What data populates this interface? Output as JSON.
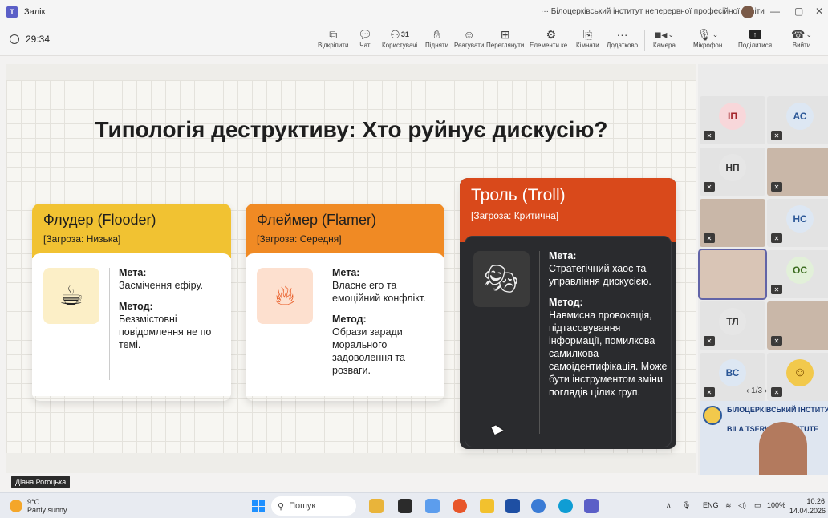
{
  "titlebar": {
    "title": "Залік",
    "org": "Білоцерківський інститут неперервної професійної освіти",
    "more": "···"
  },
  "toolbar": {
    "timer": "29:34",
    "buttons": [
      {
        "label": "Відкріпити",
        "icon": "unpin-icon"
      },
      {
        "label": "Чат",
        "icon": "chat-icon"
      },
      {
        "label": "Користувачі",
        "icon": "people-icon",
        "count": "31"
      },
      {
        "label": "Підняти",
        "icon": "raise-hand-icon"
      },
      {
        "label": "Реагувати",
        "icon": "react-icon"
      },
      {
        "label": "Переглянути",
        "icon": "view-icon"
      },
      {
        "label": "Елементи ке...",
        "icon": "apps-icon"
      },
      {
        "label": "Кімнати",
        "icon": "rooms-icon"
      },
      {
        "label": "Додатково",
        "icon": "more-icon"
      },
      {
        "label": "Камера",
        "icon": "camera-icon"
      },
      {
        "label": "Мікрофон",
        "icon": "mic-off-icon"
      },
      {
        "label": "Поділитися",
        "icon": "share-icon"
      },
      {
        "label": "Вийти",
        "icon": "leave-icon"
      }
    ]
  },
  "slide": {
    "title": "Типологія деструктиву: Хто руйнує дискусію?",
    "cards": [
      {
        "name": "Флудер (Flooder)",
        "threat": "[Загроза: Низька]",
        "goal_label": "Мета:",
        "goal": "Засмічення ефіру.",
        "method_label": "Метод:",
        "method": "Беззмістовні повідомлення не по темі."
      },
      {
        "name": "Флеймер (Flamer)",
        "threat": "[Загроза: Середня]",
        "goal_label": "Мета:",
        "goal": "Власне его та емоційний конфлікт.",
        "method_label": "Метод:",
        "method": "Образи заради морального задоволення та розваги."
      },
      {
        "name": "Троль (Troll)",
        "threat": "[Загроза: Критична]",
        "goal_label": "Мета:",
        "goal": "Стратегічний хаос та управління дискусією.",
        "method_label": "Метод:",
        "method": "Навмисна провокація, підтасовування інформації, помилкова самилкова самоідентифікація. Може бути інструментом зміни поглядів цілих груп."
      }
    ]
  },
  "speaker": "Діана Рогоцька",
  "gallery": {
    "participants": [
      "ІП",
      "АС",
      "НП",
      "",
      "",
      "НС",
      "",
      "ОС",
      "ТЛ",
      "",
      "ВС",
      ""
    ],
    "pager": "1/3",
    "banner_line1": "БІЛОЦЕРКІВСЬКИЙ ІНСТИТУТ",
    "banner_line2": "BILA TSERKVA INSTITUTE"
  },
  "taskbar": {
    "temp": "9°C",
    "weather": "Partly sunny",
    "search": "Пошук",
    "lang": "ENG",
    "battery": "100%",
    "time": "10:26",
    "date": "14.04.2026"
  }
}
